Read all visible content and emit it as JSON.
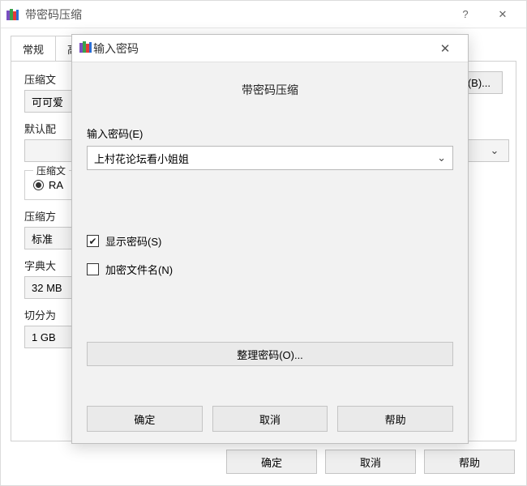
{
  "parent": {
    "title": "带密码压缩",
    "tabs": [
      "常规",
      "高"
    ],
    "labels": {
      "archive_name": "压缩文",
      "default_config": "默认配",
      "format_legend": "压缩文",
      "method": "压缩方",
      "dict": "字典大",
      "split": "切分为"
    },
    "values": {
      "archive_name": "可可爱",
      "format_option": "RA",
      "method": "标准",
      "dict": "32 MB",
      "split": "1 GB"
    },
    "buttons": {
      "browse": "(B)...",
      "ok": "确定",
      "cancel": "取消",
      "help": "帮助"
    }
  },
  "modal": {
    "title": "输入密码",
    "heading": "带密码压缩",
    "pw_label": "输入密码(E)",
    "pw_value": "上村花论坛看小姐姐",
    "show_password": "显示密码(S)",
    "encrypt_names": "加密文件名(N)",
    "organize": "整理密码(O)...",
    "ok": "确定",
    "cancel": "取消",
    "help": "帮助"
  }
}
